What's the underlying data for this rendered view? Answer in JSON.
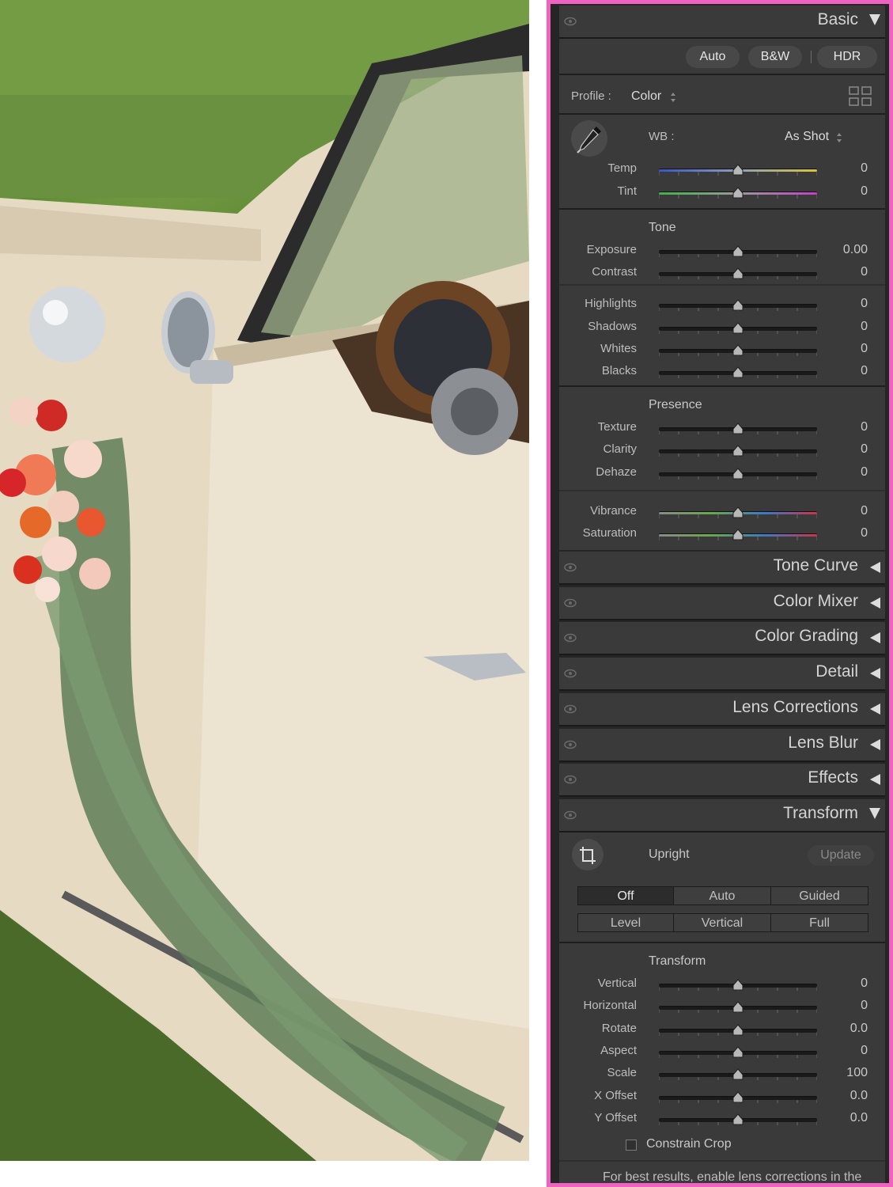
{
  "basic": {
    "title": "Basic",
    "auto_label": "Auto",
    "bw_label": "B&W",
    "hdr_label": "HDR",
    "profile_label": "Profile :",
    "profile_value": "Color",
    "wb_label": "WB :",
    "wb_value": "As Shot",
    "wb_sliders": [
      {
        "label": "Temp",
        "value": "0"
      },
      {
        "label": "Tint",
        "value": "0"
      }
    ],
    "tone_title": "Tone",
    "tone_sliders": [
      {
        "label": "Exposure",
        "value": "0.00"
      },
      {
        "label": "Contrast",
        "value": "0"
      },
      {
        "label": "Highlights",
        "value": "0"
      },
      {
        "label": "Shadows",
        "value": "0"
      },
      {
        "label": "Whites",
        "value": "0"
      },
      {
        "label": "Blacks",
        "value": "0"
      }
    ],
    "presence_title": "Presence",
    "presence_sliders": [
      {
        "label": "Texture",
        "value": "0"
      },
      {
        "label": "Clarity",
        "value": "0"
      },
      {
        "label": "Dehaze",
        "value": "0"
      },
      {
        "label": "Vibrance",
        "value": "0"
      },
      {
        "label": "Saturation",
        "value": "0"
      }
    ]
  },
  "collapsed_panels": [
    {
      "title": "Tone Curve"
    },
    {
      "title": "Color Mixer"
    },
    {
      "title": "Color Grading"
    },
    {
      "title": "Detail"
    },
    {
      "title": "Lens Corrections"
    },
    {
      "title": "Lens Blur"
    },
    {
      "title": "Effects"
    }
  ],
  "transform": {
    "title": "Transform",
    "upright_label": "Upright",
    "update_label": "Update",
    "modes_row1": [
      "Off",
      "Auto",
      "Guided"
    ],
    "modes_row2": [
      "Level",
      "Vertical",
      "Full"
    ],
    "active_mode": "Off",
    "sub_title": "Transform",
    "sliders": [
      {
        "label": "Vertical",
        "value": "0"
      },
      {
        "label": "Horizontal",
        "value": "0"
      },
      {
        "label": "Rotate",
        "value": "0.0"
      },
      {
        "label": "Aspect",
        "value": "0"
      },
      {
        "label": "Scale",
        "value": "100"
      },
      {
        "label": "X Offset",
        "value": "0.0"
      },
      {
        "label": "Y Offset",
        "value": "0.0"
      }
    ],
    "constrain_crop_label": "Constrain Crop",
    "constrain_crop_checked": false,
    "footer_note": "For best results, enable lens corrections in the"
  },
  "colors": {
    "panel_border": "#f062c0",
    "panel_bg": "#3a3a3a"
  }
}
